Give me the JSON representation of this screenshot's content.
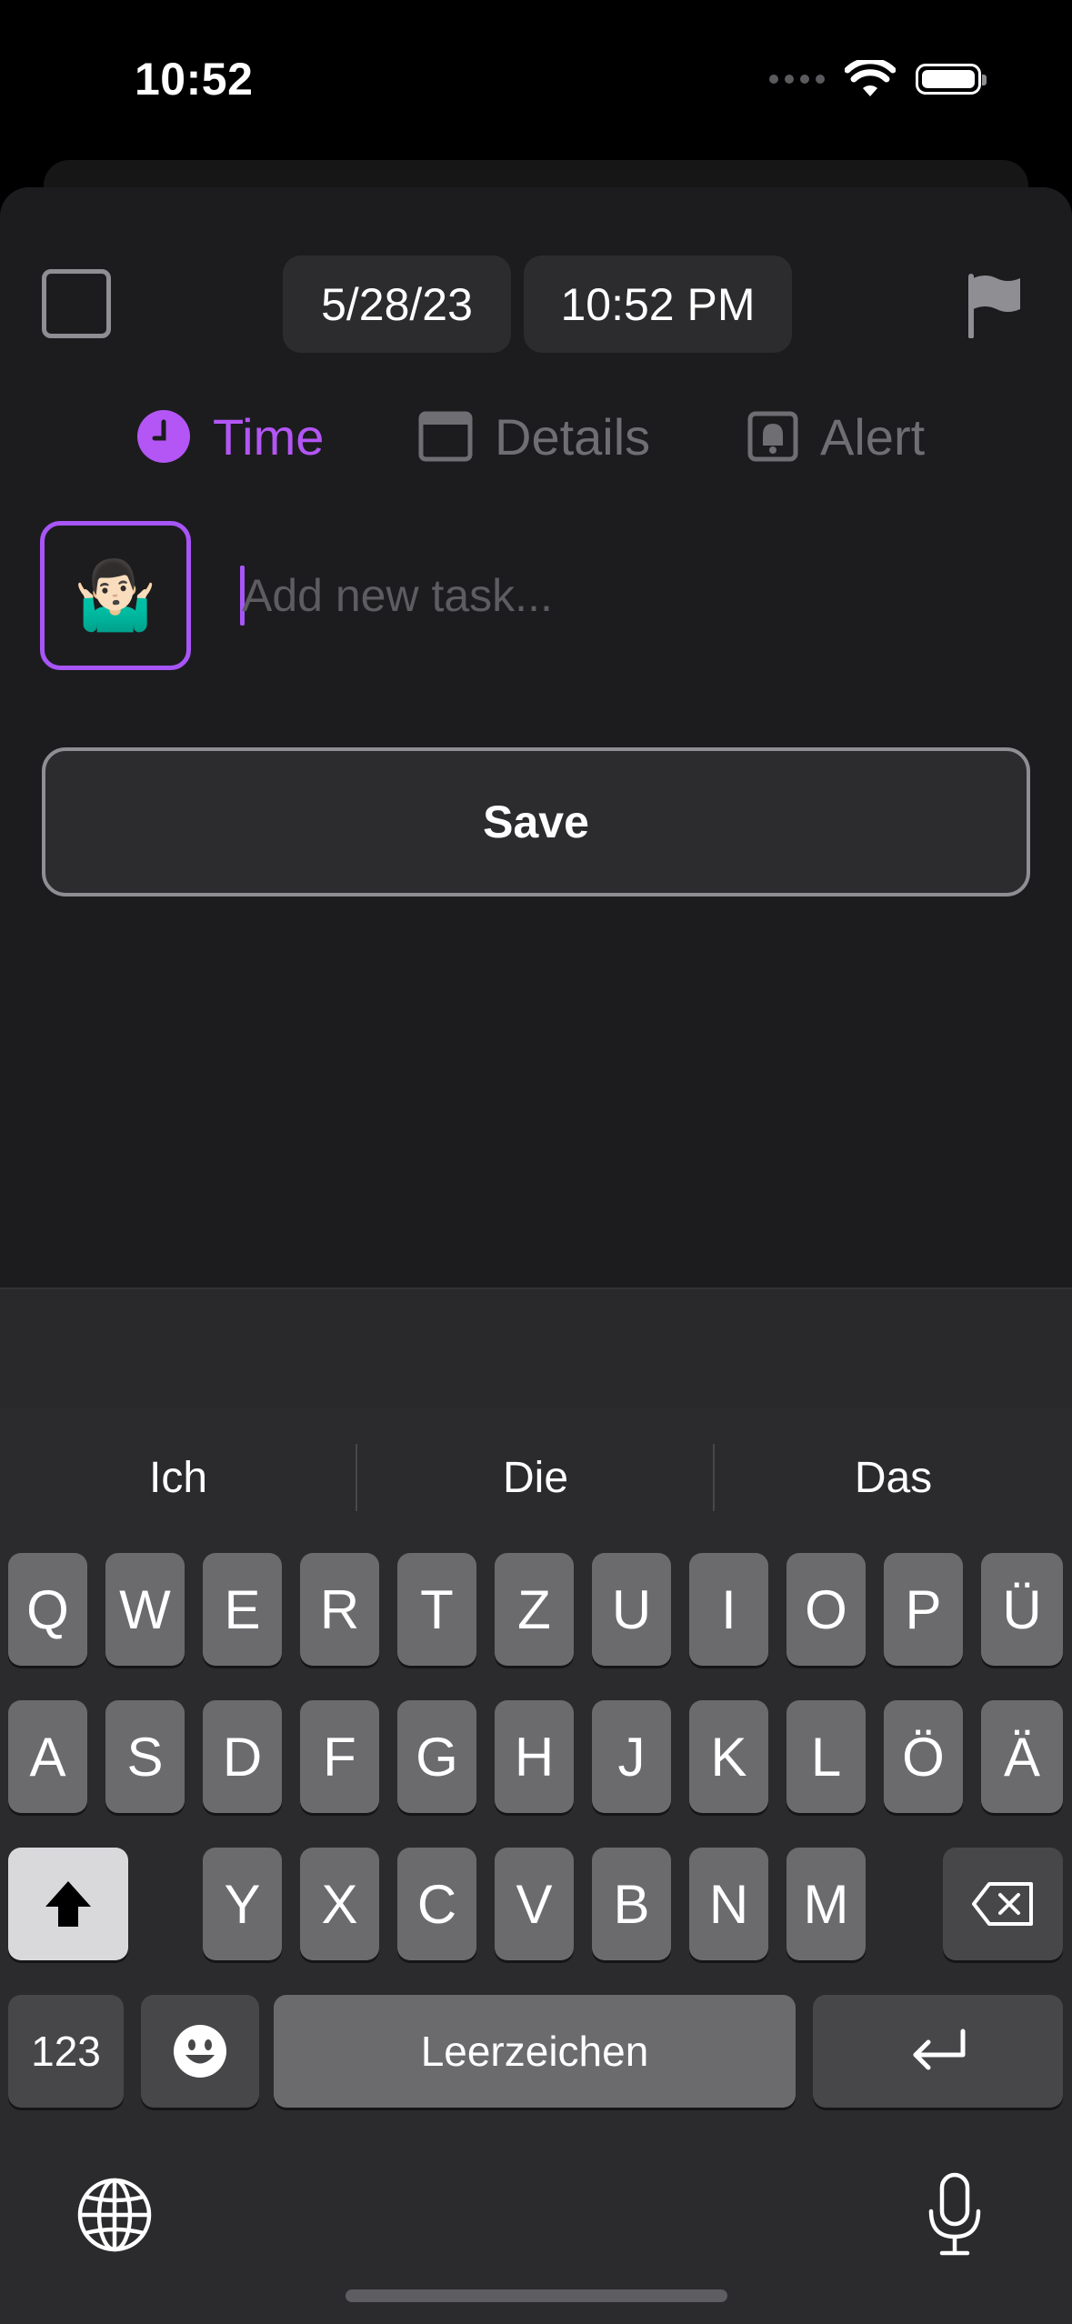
{
  "status_bar": {
    "time": "10:52"
  },
  "header": {
    "date": "5/28/23",
    "time": "10:52 PM"
  },
  "tabs": [
    {
      "label": "Time",
      "active": true
    },
    {
      "label": "Details",
      "active": false
    },
    {
      "label": "Alert",
      "active": false
    }
  ],
  "task": {
    "emoji": "🤷🏻‍♂️",
    "placeholder": "Add new task...",
    "value": ""
  },
  "save_label": "Save",
  "colors": {
    "accent": "#a855f7",
    "background": "#1c1c1e",
    "muted": "#6e6e73"
  },
  "keyboard": {
    "suggestions": [
      "Ich",
      "Die",
      "Das"
    ],
    "row1": [
      "Q",
      "W",
      "E",
      "R",
      "T",
      "Z",
      "U",
      "I",
      "O",
      "P",
      "Ü"
    ],
    "row2": [
      "A",
      "S",
      "D",
      "F",
      "G",
      "H",
      "J",
      "K",
      "L",
      "Ö",
      "Ä"
    ],
    "row3": [
      "Y",
      "X",
      "C",
      "V",
      "B",
      "N",
      "M"
    ],
    "numbers_label": "123",
    "space_label": "Leerzeichen"
  }
}
